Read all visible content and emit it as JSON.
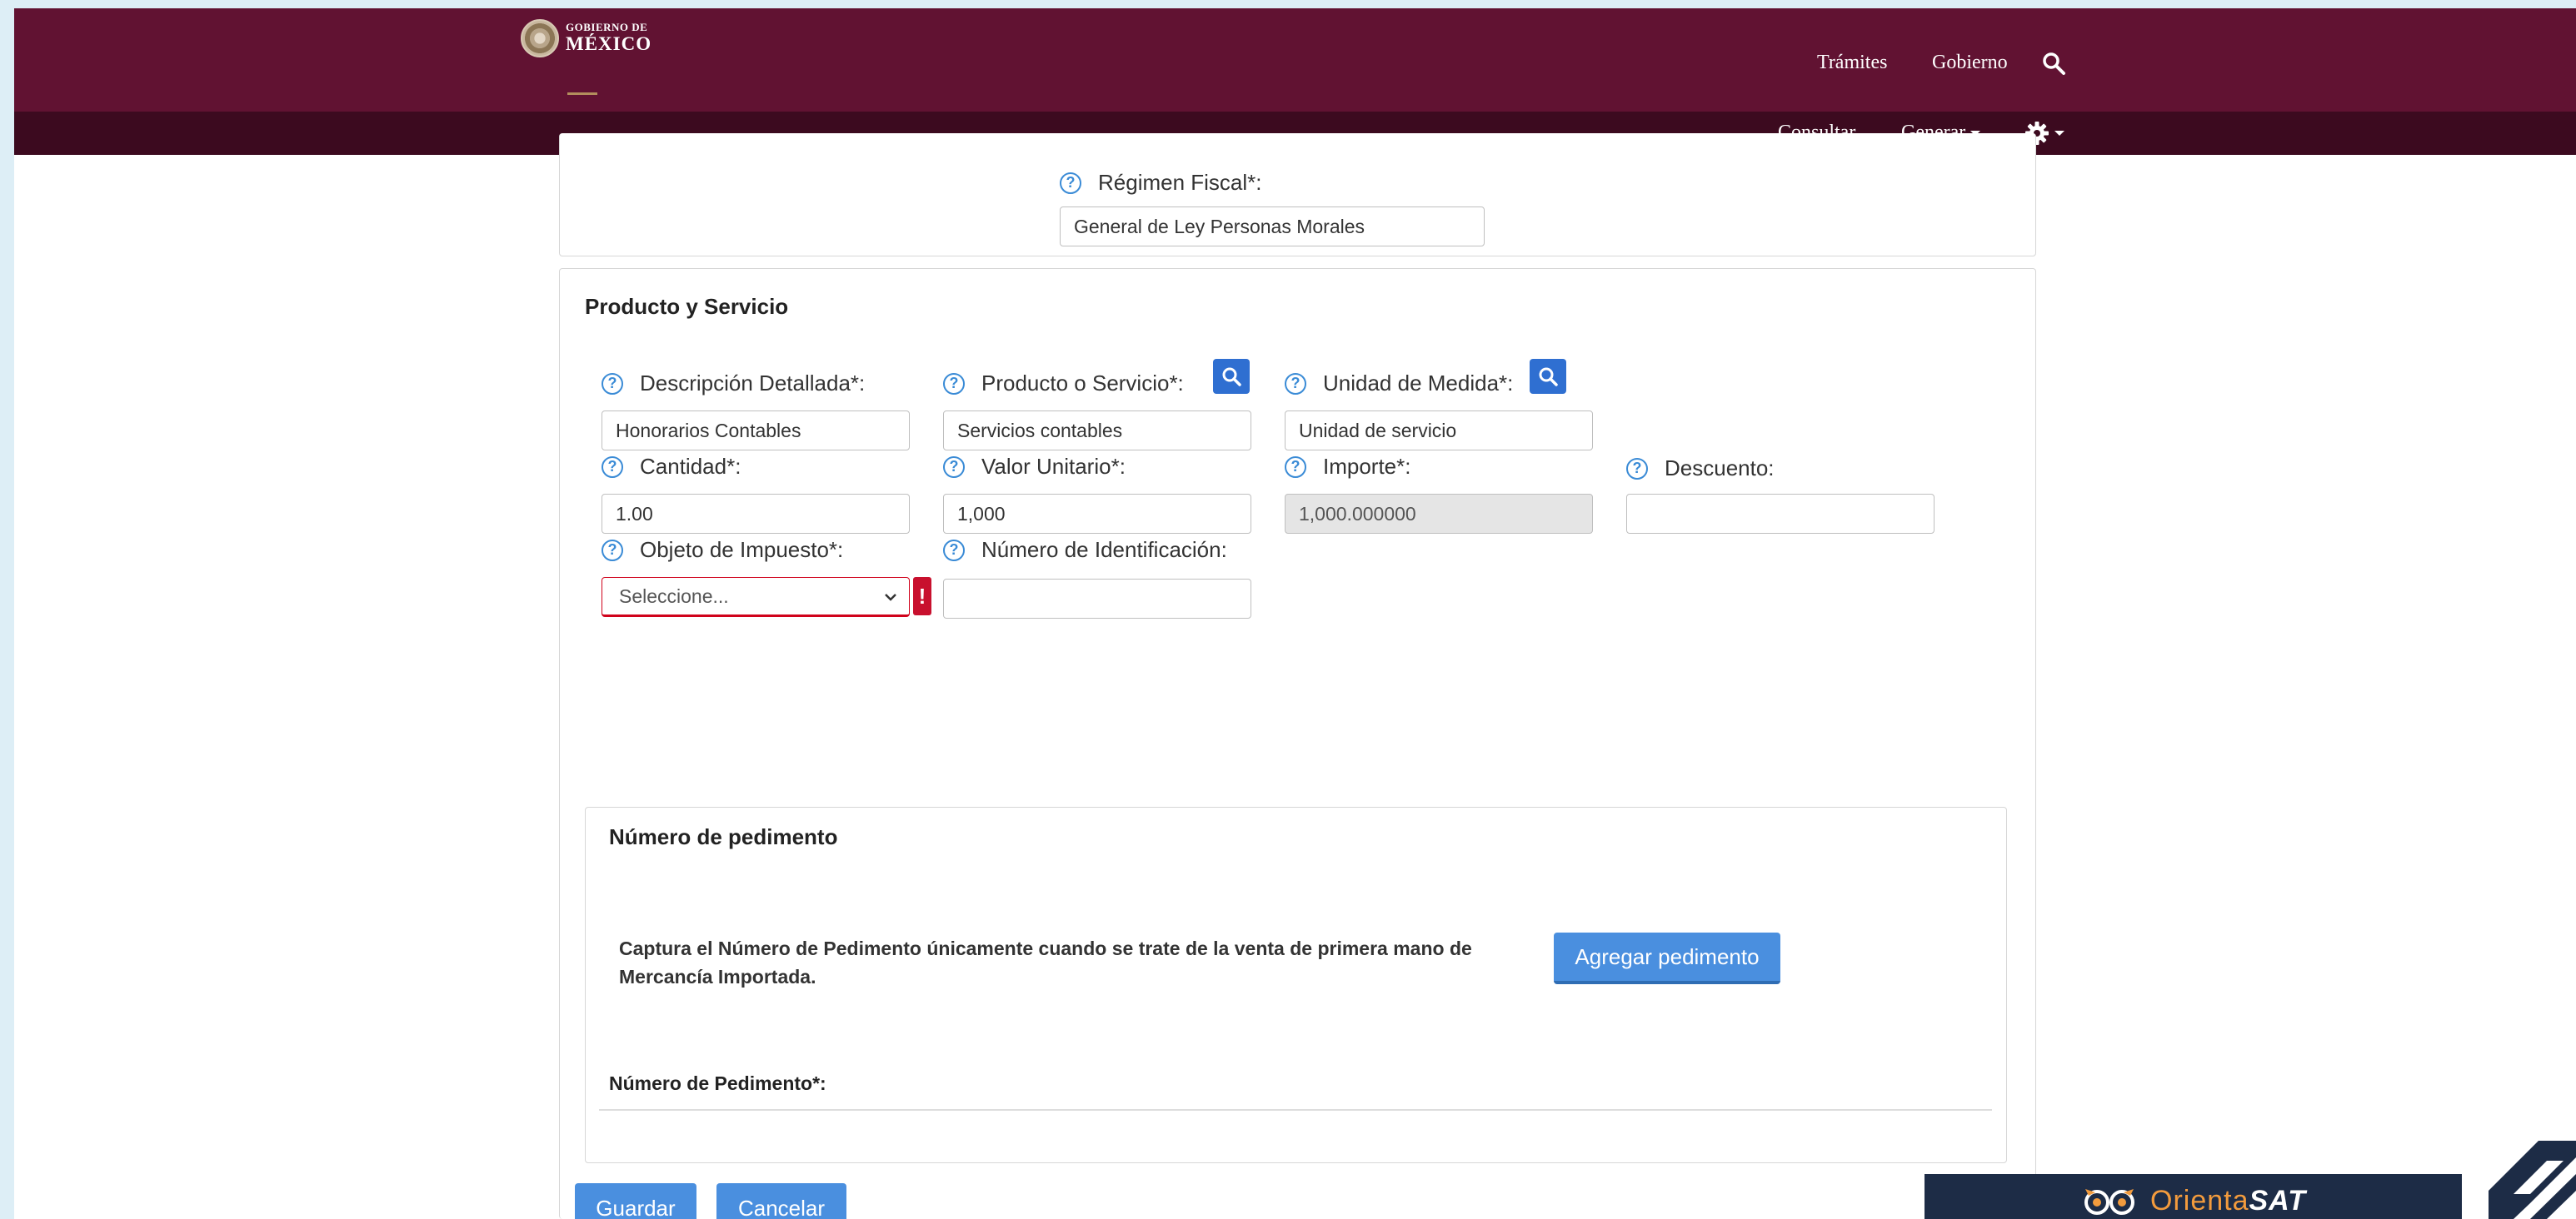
{
  "header": {
    "logo_line1": "GOBIERNO DE",
    "logo_line2": "MÉXICO",
    "nav_tramites": "Trámites",
    "nav_gobierno": "Gobierno",
    "sub_consultar": "Consultar",
    "sub_generar": "Generar"
  },
  "regimen": {
    "label": "Régimen Fiscal*:",
    "value": "General de Ley Personas Morales"
  },
  "producto": {
    "title": "Producto y Servicio",
    "descripcion_label": "Descripción Detallada*:",
    "descripcion_value": "Honorarios Contables",
    "producto_label": "Producto o Servicio*:",
    "producto_value": "Servicios contables",
    "unidad_label": "Unidad de Medida*:",
    "unidad_value": "Unidad de servicio",
    "cantidad_label": "Cantidad*:",
    "cantidad_value": "1.00",
    "valor_label": "Valor Unitario*:",
    "valor_value": "1,000",
    "importe_label": "Importe*:",
    "importe_value": "1,000.000000",
    "descuento_label": "Descuento:",
    "descuento_value": "",
    "objeto_label": "Objeto de Impuesto*:",
    "objeto_selected": "Seleccione...",
    "numero_id_label": "Número de Identificación:",
    "numero_id_value": "",
    "error_mark": "!"
  },
  "pedimento": {
    "title": "Número de pedimento",
    "note": "Captura el Número de Pedimento únicamente cuando se trate de la venta de primera mano de Mercancía Importada.",
    "add_button": "Agregar pedimento",
    "column_header": "Número de Pedimento*:"
  },
  "actions": {
    "save": "Guardar",
    "cancel": "Cancelar"
  },
  "branding": {
    "orienta_text": "Orienta",
    "orienta_bold": "SAT"
  },
  "colors": {
    "header_primary": "#611232",
    "header_secondary": "#3c0a1f",
    "accent_blue": "#4a8fdf",
    "error_red": "#c8102e"
  }
}
